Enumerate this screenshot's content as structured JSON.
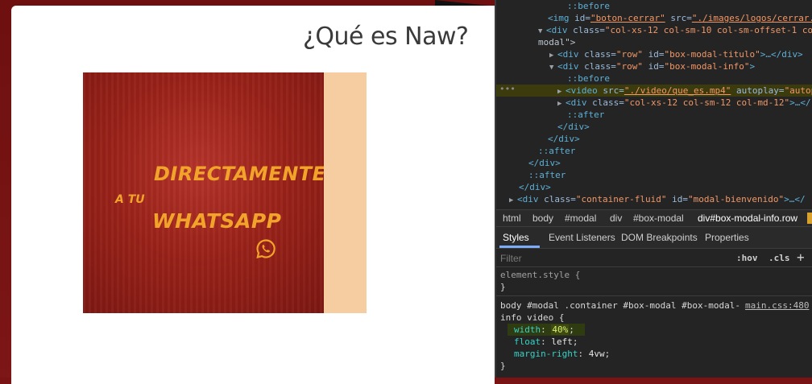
{
  "modal": {
    "title": "¿Qué es Naw?"
  },
  "video": {
    "line1": "DIRECTAMENTE",
    "line2": "A TU",
    "line3": "WHATSAPP",
    "icon": "whatsapp-icon"
  },
  "dom": [
    {
      "tri": "",
      "pseudo": "::before"
    },
    {
      "tri": "",
      "tag_open": "<img",
      "a1": " id=",
      "v1": "\"boton-cerrar\"",
      "a2": " src=",
      "v2": "\"./images/logos/cerrar."
    },
    {
      "tri": "▼",
      "tag_open": "<div",
      "a1": " class=",
      "v1": "\"col-xs-12 col-sm-10 col-sm-offset-1 col"
    },
    {
      "tri": "",
      "text": "modal\">"
    },
    {
      "tri": "▶",
      "tag_open": "<div",
      "a1": " class=",
      "v1": "\"row\"",
      "a2": " id=",
      "v2": "\"box-modal-titulo\"",
      "tail": ">…</div>"
    },
    {
      "tri": "▼",
      "tag_open": "<div",
      "a1": " class=",
      "v1": "\"row\"",
      "a2": " id=",
      "v2": "\"box-modal-info\"",
      "tail": ">"
    },
    {
      "tri": "",
      "pseudo": "::before"
    },
    {
      "tri": "▶",
      "tag_open": "<video",
      "a1": " src=",
      "v1": "\"./video/que_es.mp4\"",
      "a2": " autoplay=",
      "v2": "\"autop"
    },
    {
      "tri": "▶",
      "tag_open": "<div",
      "a1": " class=",
      "v1": "\"col-xs-12 col-sm-12 col-md-12\"",
      "tail": ">…</"
    },
    {
      "tri": "",
      "pseudo": "::after"
    },
    {
      "tri": "",
      "tag_close": "</div>"
    },
    {
      "tri": "",
      "tag_close": "</div>"
    },
    {
      "tri": "",
      "pseudo": "::after"
    },
    {
      "tri": "",
      "tag_close": "</div>"
    },
    {
      "tri": "",
      "pseudo": "::after"
    },
    {
      "tri": "",
      "tag_close": "</div>"
    },
    {
      "tri": "▶",
      "tag_open": "<div",
      "a1": " class=",
      "v1": "\"container-fluid\"",
      "a2": " id=",
      "v2": "\"modal-bienvenido\"",
      "tail": ">…</"
    }
  ],
  "breadcrumbs": [
    "html",
    "body",
    "#modal",
    "div",
    "#box-modal",
    "div#box-modal-info.row",
    "video"
  ],
  "tabs": [
    "Styles",
    "Event Listeners",
    "DOM Breakpoints",
    "Properties"
  ],
  "filter": {
    "placeholder": "Filter",
    "hov": ":hov",
    "cls": ".cls",
    "add": "+"
  },
  "styles": {
    "element_style": "element.style {",
    "close_brace": "}",
    "selector_line1": "body #modal .container #box-modal #box-modal-",
    "selector_line2": "info video {",
    "source": "main.css:480",
    "props": [
      {
        "name": "width",
        "value": "40%"
      },
      {
        "name": "float",
        "value": "left"
      },
      {
        "name": "margin-right",
        "value": "4vw"
      }
    ]
  }
}
